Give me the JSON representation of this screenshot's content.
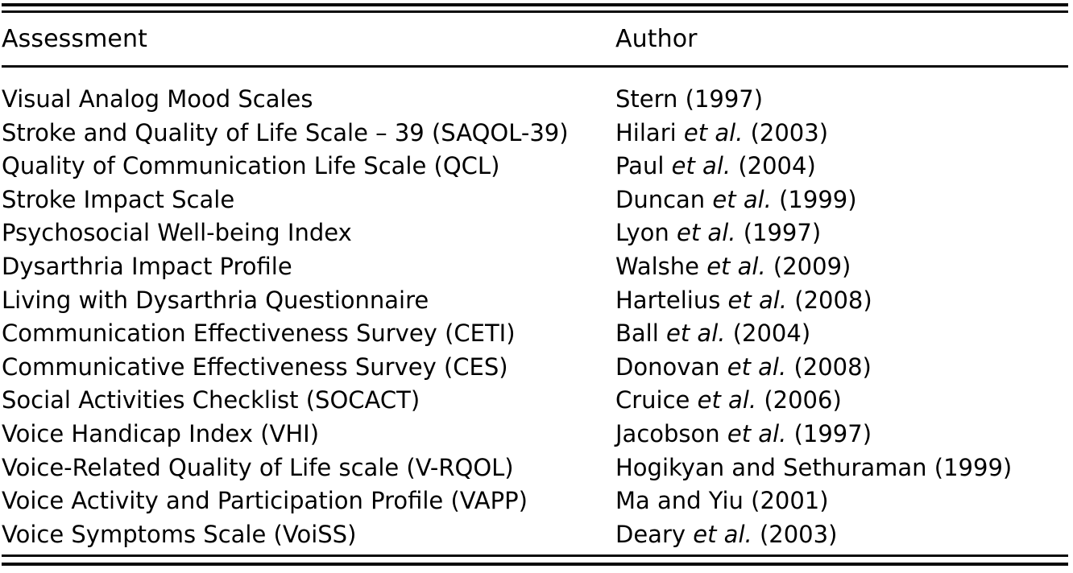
{
  "table": {
    "columns": [
      {
        "key": "assessment",
        "label": "Assessment"
      },
      {
        "key": "author",
        "label": "Author"
      }
    ],
    "rows": [
      {
        "assessment": "Visual Analog Mood Scales",
        "author_name": "Stern",
        "author_etal": "",
        "author_year": "(1997)",
        "author": "Stern (1997)"
      },
      {
        "assessment": "Stroke and Quality of Life Scale – 39 (SAQOL-39)",
        "author_name": "Hilari",
        "author_etal": "et al.",
        "author_year": "(2003)",
        "author": "Hilari et al. (2003)"
      },
      {
        "assessment": "Quality of Communication Life Scale (QCL)",
        "author_name": "Paul",
        "author_etal": "et al.",
        "author_year": "(2004)",
        "author": "Paul et al. (2004)"
      },
      {
        "assessment": "Stroke Impact Scale",
        "author_name": "Duncan",
        "author_etal": "et al.",
        "author_year": "(1999)",
        "author": "Duncan et al. (1999)"
      },
      {
        "assessment": "Psychosocial Well-being Index",
        "author_name": "Lyon",
        "author_etal": "et al.",
        "author_year": "(1997)",
        "author": "Lyon et al. (1997)"
      },
      {
        "assessment": "Dysarthria Impact Profile",
        "author_name": "Walshe",
        "author_etal": "et al.",
        "author_year": "(2009)",
        "author": "Walshe et al. (2009)"
      },
      {
        "assessment": "Living with Dysarthria Questionnaire",
        "author_name": "Hartelius",
        "author_etal": "et al.",
        "author_year": "(2008)",
        "author": "Hartelius et al. (2008)"
      },
      {
        "assessment": "Communication Effectiveness Survey (CETI)",
        "author_name": "Ball",
        "author_etal": "et al.",
        "author_year": "(2004)",
        "author": "Ball et al. (2004)"
      },
      {
        "assessment": "Communicative Effectiveness Survey (CES)",
        "author_name": "Donovan",
        "author_etal": "et al.",
        "author_year": "(2008)",
        "author": "Donovan et al. (2008)"
      },
      {
        "assessment": "Social Activities Checklist (SOCACT)",
        "author_name": "Cruice",
        "author_etal": "et al.",
        "author_year": "(2006)",
        "author": "Cruice et al. (2006)"
      },
      {
        "assessment": "Voice Handicap Index (VHI)",
        "author_name": "Jacobson",
        "author_etal": "et al.",
        "author_year": "(1997)",
        "author": "Jacobson et al. (1997)"
      },
      {
        "assessment": "Voice-Related Quality of Life scale (V-RQOL)",
        "author_name": "Hogikyan and Sethuraman",
        "author_etal": "",
        "author_year": "(1999)",
        "author": "Hogikyan and Sethuraman (1999)"
      },
      {
        "assessment": "Voice Activity and Participation Profile (VAPP)",
        "author_name": "Ma and Yiu",
        "author_etal": "",
        "author_year": "(2001)",
        "author": "Ma and Yiu (2001)"
      },
      {
        "assessment": "Voice Symptoms Scale (VoiSS)",
        "author_name": "Deary",
        "author_etal": "et al.",
        "author_year": "(2003)",
        "author": "Deary et al. (2003)"
      }
    ]
  },
  "style": {
    "rule_color": "#0a0a0a",
    "text_color": "#000000",
    "background": "#ffffff"
  }
}
